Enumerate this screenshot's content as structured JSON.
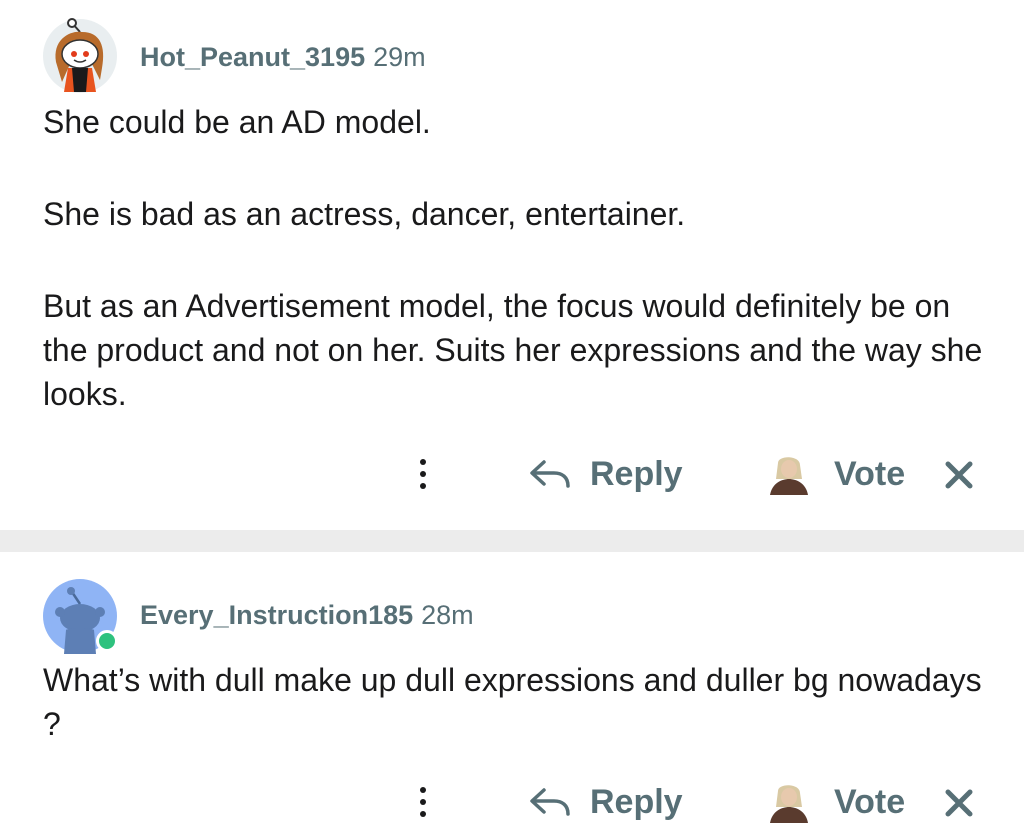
{
  "comments": [
    {
      "author": "Hot_Peanut_3195",
      "time": "29m",
      "avatar_icon": "reddit-snoo-avatar-orange-hair",
      "paragraphs": [
        "She could be an AD model.",
        "She is bad as an actress, dancer, entertainer.",
        "But as an Advertisement model, the focus would definitely be on the product and not on her. Suits her expressions and the way she looks."
      ],
      "actions": {
        "more_icon": "more-vertical-icon",
        "reply_icon": "reply-arrow-icon",
        "reply_label": "Reply",
        "vote_icon": "vote-avatar-icon",
        "vote_label": "Vote",
        "close_icon": "close-icon"
      }
    },
    {
      "author": "Every_Instruction185",
      "time": "28m",
      "avatar_icon": "reddit-snoo-avatar-default-blue",
      "online": true,
      "paragraphs": [
        "What’s with dull make up dull expressions and duller bg nowadays ?"
      ],
      "actions": {
        "more_icon": "more-vertical-icon",
        "reply_icon": "reply-arrow-icon",
        "reply_label": "Reply",
        "vote_icon": "vote-avatar-icon",
        "vote_label": "Vote",
        "close_icon": "close-icon"
      }
    }
  ],
  "colors": {
    "text": "#1a1a1b",
    "meta": "#576f76",
    "separator": "#ececec",
    "online": "#2ec27e",
    "default_avatar_bg": "#8fb4f5"
  }
}
